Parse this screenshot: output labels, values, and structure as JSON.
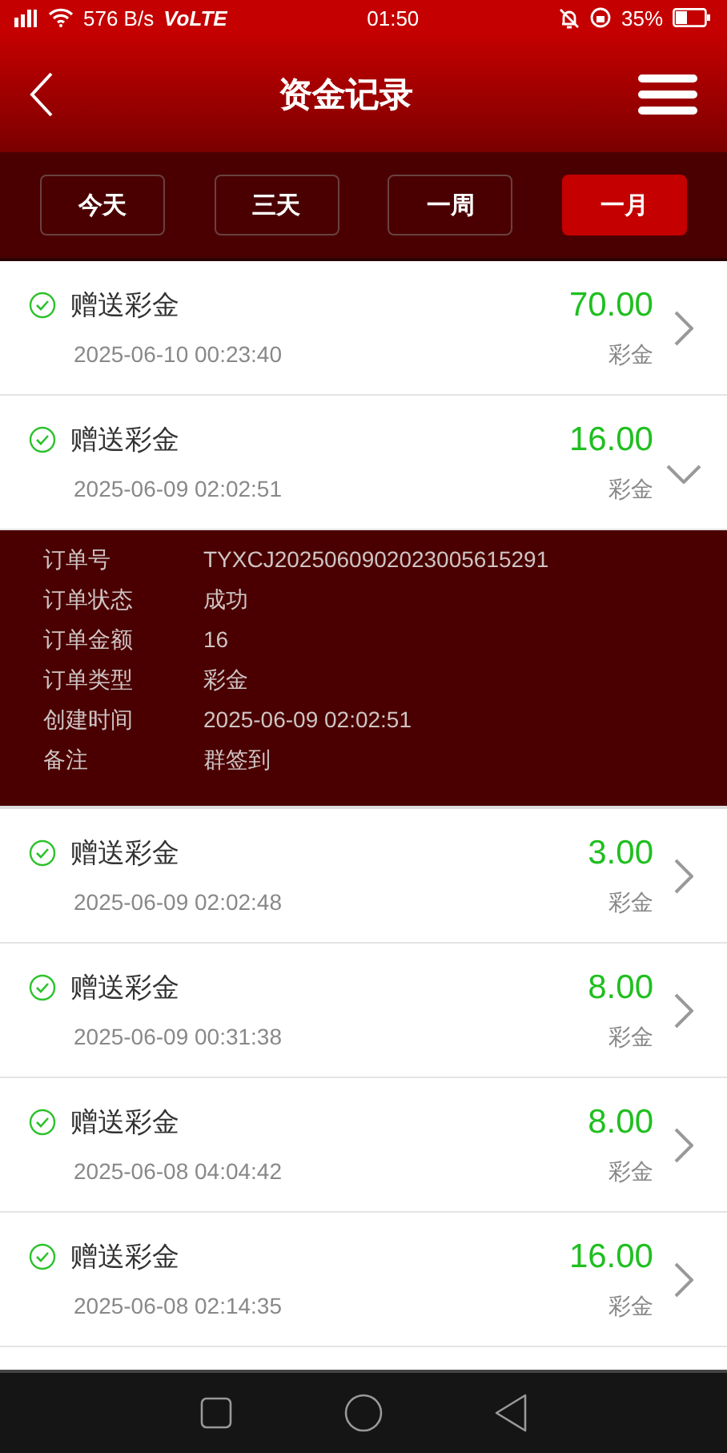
{
  "status_bar": {
    "speed": "576 B/s",
    "network": "VoLTE",
    "time": "01:50",
    "battery": "35%"
  },
  "header": {
    "title": "资金记录"
  },
  "filters": [
    {
      "label": "今天",
      "selected": false
    },
    {
      "label": "三天",
      "selected": false
    },
    {
      "label": "一周",
      "selected": false
    },
    {
      "label": "一月",
      "selected": true
    }
  ],
  "records": [
    {
      "title": "赠送彩金",
      "amount": "70.00",
      "date": "2025-06-10 00:23:40",
      "type": "彩金",
      "expanded": false
    },
    {
      "title": "赠送彩金",
      "amount": "16.00",
      "date": "2025-06-09 02:02:51",
      "type": "彩金",
      "expanded": true,
      "details": [
        {
          "label": "订单号",
          "value": "TYXCJ2025060902023005615291"
        },
        {
          "label": "订单状态",
          "value": "成功"
        },
        {
          "label": "订单金额",
          "value": "16"
        },
        {
          "label": "订单类型",
          "value": "彩金"
        },
        {
          "label": "创建时间",
          "value": "2025-06-09 02:02:51"
        },
        {
          "label": "备注",
          "value": "群签到"
        }
      ]
    },
    {
      "title": "赠送彩金",
      "amount": "3.00",
      "date": "2025-06-09 02:02:48",
      "type": "彩金",
      "expanded": false
    },
    {
      "title": "赠送彩金",
      "amount": "8.00",
      "date": "2025-06-09 00:31:38",
      "type": "彩金",
      "expanded": false
    },
    {
      "title": "赠送彩金",
      "amount": "8.00",
      "date": "2025-06-08 04:04:42",
      "type": "彩金",
      "expanded": false
    },
    {
      "title": "赠送彩金",
      "amount": "16.00",
      "date": "2025-06-08 02:14:35",
      "type": "彩金",
      "expanded": false
    }
  ]
}
